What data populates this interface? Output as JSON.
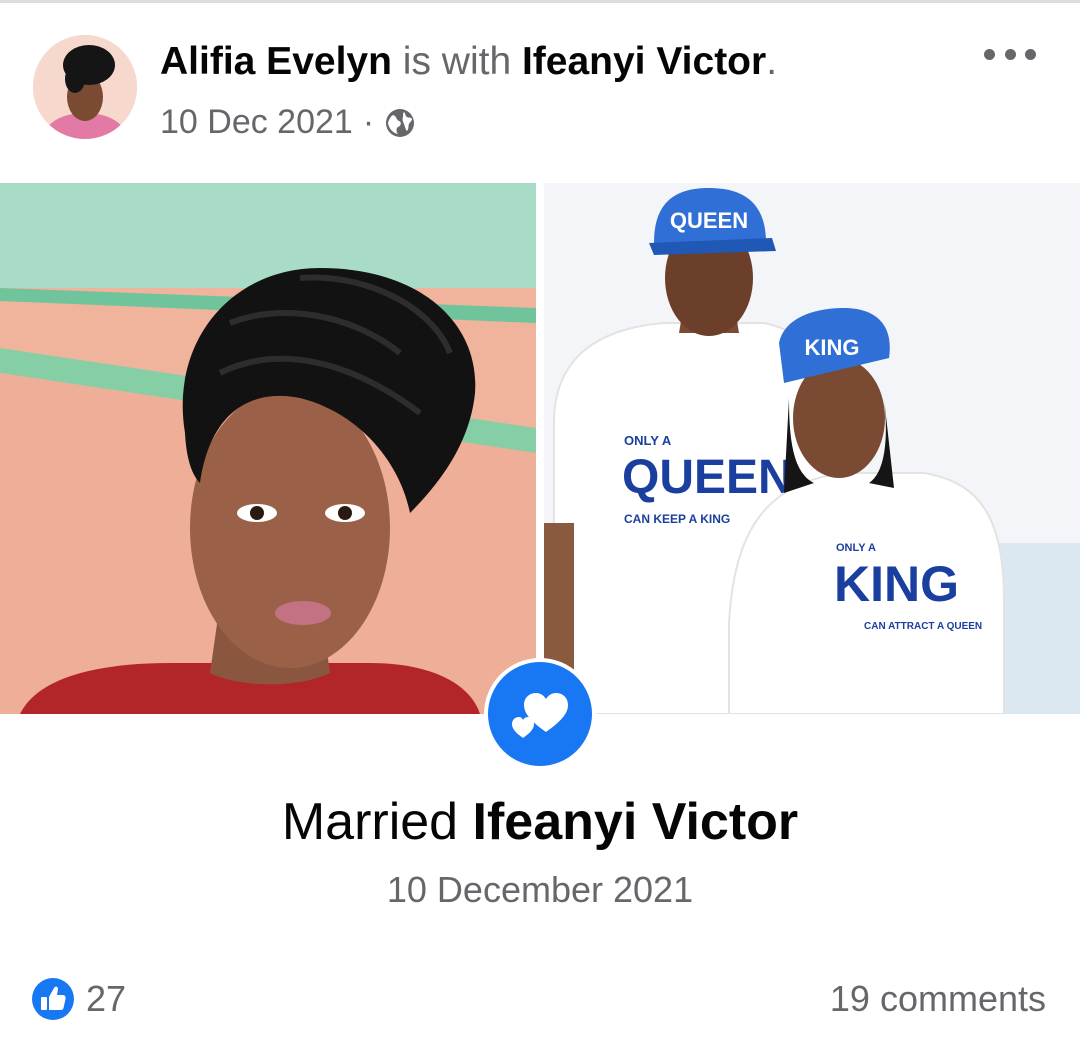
{
  "post": {
    "author": "Alifia Evelyn",
    "connector": " is with ",
    "tagged_user": "Ifeanyi Victor",
    "trailing_period": ".",
    "date": "10 Dec 2021",
    "separator": "·",
    "privacy_icon": "globe-icon",
    "more_icon": "more-options-icon"
  },
  "photos": {
    "left_shirt_cap": "",
    "right_cap_left": "QUEEN",
    "right_cap_right": "KING",
    "shirt_left_top": "ONLY A",
    "shirt_left_main": "QUEEN",
    "shirt_left_bottom": "CAN KEEP A KING",
    "shirt_right_top": "ONLY A",
    "shirt_right_main": "KING",
    "shirt_right_bottom": "CAN ATTRACT A QUEEN"
  },
  "life_event": {
    "icon": "hearts-icon",
    "title_prefix": "Married ",
    "title_name": "Ifeanyi Victor",
    "date": "10 December 2021"
  },
  "engagement": {
    "like_icon": "like-thumb-icon",
    "like_count": "27",
    "comments_label": "19 comments"
  },
  "colors": {
    "accent": "#1877f2",
    "secondary_text": "#65676b",
    "primary_text": "#050505"
  }
}
